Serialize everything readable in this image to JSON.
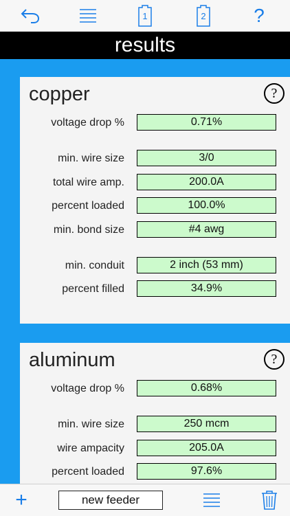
{
  "toolbar": {
    "icons": [
      "back-arrow-icon",
      "menu-icon",
      "document-1-icon",
      "document-2-icon",
      "help-icon"
    ],
    "doc1_label": "1",
    "doc2_label": "2",
    "help_label": "?",
    "accent_color": "#1a7ee8"
  },
  "title": "results",
  "copper": {
    "title": "copper",
    "help": "?",
    "rows": [
      {
        "label": "voltage drop %",
        "value": "0.71%"
      },
      {
        "label": "min. wire size",
        "value": "3/0"
      },
      {
        "label": "total wire amp.",
        "value": "200.0A"
      },
      {
        "label": "percent loaded",
        "value": "100.0%"
      },
      {
        "label": "min. bond size",
        "value": "#4 awg"
      },
      {
        "label": "min. conduit",
        "value": "2 inch (53 mm)"
      },
      {
        "label": "percent filled",
        "value": "34.9%"
      }
    ]
  },
  "aluminum": {
    "title": "aluminum",
    "help": "?",
    "rows": [
      {
        "label": "voltage drop %",
        "value": "0.68%"
      },
      {
        "label": "min. wire size",
        "value": "250 mcm"
      },
      {
        "label": "wire ampacity",
        "value": "205.0A"
      },
      {
        "label": "percent loaded",
        "value": "97.6%"
      }
    ]
  },
  "bottombar": {
    "add_label": "+",
    "new_feeder_label": "new feeder",
    "icons": [
      "plus-icon",
      "list-icon",
      "trash-icon"
    ]
  },
  "colors": {
    "background": "#1a9cf0",
    "value_fill": "#ccfacc",
    "title_bar": "#000000"
  }
}
